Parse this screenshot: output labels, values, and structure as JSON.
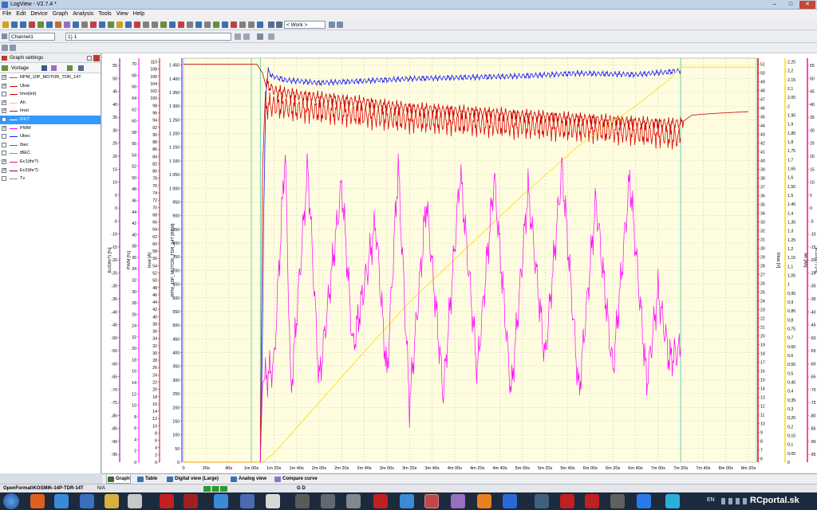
{
  "window": {
    "title": "LogView - V2.7.4 *"
  },
  "menu": [
    "File",
    "Edit",
    "Device",
    "Graph",
    "Analysis",
    "Tools",
    "View",
    "Help"
  ],
  "toolbar": {
    "work_select": "< Work >"
  },
  "channel_bar": {
    "channel_select": "Channel1",
    "session_select": "1) 1"
  },
  "settings": {
    "title": "Graph settings",
    "profile_select": "Vorlage"
  },
  "channels": [
    {
      "label": "RPM_10P_MOTOR_TDR_14T",
      "checked": true,
      "color": "#ff3333"
    },
    {
      "label": "Ubat",
      "checked": true,
      "color": "#cc0000"
    },
    {
      "label": "Imot(int)",
      "checked": false,
      "color": "#bb0000"
    },
    {
      "label": "Ah",
      "checked": true,
      "color": "#ffd800"
    },
    {
      "label": "Imot",
      "checked": true,
      "color": "#e00000"
    },
    {
      "label": "tFET",
      "checked": false,
      "color": "#ffffff",
      "selected": true
    },
    {
      "label": "PWM",
      "checked": true,
      "color": "#ff00ff"
    },
    {
      "label": "Ubec",
      "checked": false,
      "color": "#1a1aff"
    },
    {
      "label": "Ibec",
      "checked": false,
      "color": "#00aa00"
    },
    {
      "label": "tBEC",
      "checked": false,
      "color": "#00c8c8"
    },
    {
      "label": "Ec1(thr?)",
      "checked": true,
      "color": "#ff0080"
    },
    {
      "label": "Ec2(thr?)",
      "checked": true,
      "color": "#800080"
    },
    {
      "label": "Tv",
      "checked": false,
      "color": "#888888"
    }
  ],
  "bottom_tabs": [
    "Graph",
    "Table",
    "Digital view (Large)",
    "Analog view",
    "Compare curve"
  ],
  "status": {
    "file": "OpenFormat\\KOSMIK-14P-TDR-14T",
    "na": "N/A",
    "gd": "G D"
  },
  "taskbar": {
    "lang": "EN",
    "watermark": "RCportal.sk"
  },
  "chart_data": {
    "type": "line",
    "x_ticks": [
      "0",
      "20s",
      "40s",
      "1m 00s",
      "1m 20s",
      "1m 40s",
      "2m 00s",
      "2m 20s",
      "2m 40s",
      "3m 00s",
      "3m 20s",
      "3m 40s",
      "4m 00s",
      "4m 20s",
      "4m 40s",
      "5m 00s",
      "5m 20s",
      "5m 40s",
      "6m 00s",
      "6m 20s",
      "6m 40s",
      "7m 00s",
      "7m 20s",
      "7m 40s",
      "8m 00s",
      "8m 20s"
    ],
    "x_unit_seconds": [
      0,
      20,
      40,
      60,
      80,
      100,
      120,
      140,
      160,
      180,
      200,
      220,
      240,
      260,
      280,
      300,
      320,
      340,
      360,
      380,
      400,
      420,
      440,
      460,
      480,
      500
    ],
    "x_range_seconds": [
      0,
      507
    ],
    "grid": true,
    "plot_background": "#fffde0",
    "axes_left": [
      {
        "id": "ec2",
        "label": "Ec2(thr?) [%]",
        "color": "#800080",
        "ticks": [
          55,
          50,
          45,
          40,
          35,
          30,
          25,
          20,
          15,
          10,
          5,
          0,
          -5,
          -10,
          -15,
          -20,
          -25,
          -30,
          -35,
          -40,
          -45,
          -50,
          -55,
          -60,
          -65,
          -70,
          -75,
          -80,
          -85,
          -90,
          -95
        ]
      },
      {
        "id": "pwm",
        "label": "PWM [%]",
        "color": "#ff00ff",
        "ticks": [
          70,
          68,
          66,
          64,
          62,
          60,
          58,
          56,
          54,
          52,
          50,
          48,
          46,
          44,
          42,
          40,
          38,
          36,
          34,
          32,
          30,
          28,
          26,
          24,
          22,
          20,
          18,
          16,
          14,
          12,
          10,
          8,
          6,
          4,
          2,
          0
        ]
      },
      {
        "id": "imot",
        "label": "Imot [A]",
        "color": "#e00000",
        "ticks": [
          110,
          108,
          106,
          104,
          102,
          100,
          98,
          96,
          94,
          92,
          90,
          88,
          86,
          84,
          82,
          80,
          78,
          76,
          74,
          72,
          70,
          68,
          66,
          64,
          62,
          60,
          58,
          56,
          54,
          52,
          50,
          48,
          46,
          44,
          42,
          40,
          38,
          36,
          34,
          32,
          30,
          28,
          26,
          24,
          22,
          20,
          18,
          16,
          14,
          12,
          10,
          8,
          6,
          4,
          2,
          0
        ]
      },
      {
        "id": "rpm",
        "label": "RPM_10P_MOTOR_TDR_14T [RPM]",
        "color": "#1a1aff",
        "ticks": [
          "1 450",
          "1 400",
          "1 350",
          "1 300",
          "1 250",
          "1 200",
          "1 150",
          "1 100",
          "1 050",
          "1 000",
          "950",
          "900",
          "850",
          "800",
          "750",
          "700",
          "650",
          "600",
          "550",
          "500",
          "450",
          "400",
          "350",
          "300",
          "250",
          "200",
          "150",
          "100",
          "50",
          "0"
        ]
      }
    ],
    "axes_right": [
      {
        "id": "ubat",
        "label": "Ubat [V]",
        "color": "#cc0000",
        "ticks": [
          51,
          50,
          49,
          48,
          47,
          46,
          45,
          44,
          43,
          42,
          41,
          40,
          39,
          38,
          37,
          36,
          35,
          34,
          33,
          32,
          31,
          30,
          29,
          28,
          27,
          26,
          25,
          24,
          23,
          22,
          21,
          20,
          19,
          18,
          17,
          16,
          15,
          14,
          13,
          12,
          11,
          10,
          9,
          8,
          7,
          6
        ]
      },
      {
        "id": "ah",
        "label": "Ah [Ah]",
        "color": "#ffd800",
        "ticks": [
          "2,25",
          "2,2",
          "2,15",
          "2,1",
          "2,05",
          "2",
          "1,95",
          "1,9",
          "1,85",
          "1,8",
          "1,75",
          "1,7",
          "1,65",
          "1,6",
          "1,55",
          "1,5",
          "1,45",
          "1,4",
          "1,35",
          "1,3",
          "1,25",
          "1,2",
          "1,15",
          "1,1",
          "1,05",
          "1",
          "0,95",
          "0,9",
          "0,85",
          "0,8",
          "0,75",
          "0,7",
          "0,65",
          "0,6",
          "0,55",
          "0,5",
          "0,45",
          "0,4",
          "0,35",
          "0,3",
          "0,25",
          "0,2",
          "0,15",
          "0,1",
          "0,05",
          "0"
        ]
      },
      {
        "id": "ec1",
        "label": "Ec1(thr?) [%]",
        "color": "#ff0080",
        "ticks": [
          55,
          50,
          45,
          40,
          35,
          30,
          25,
          20,
          15,
          10,
          5,
          0,
          -5,
          -10,
          -15,
          -20,
          -25,
          -30,
          -35,
          -40,
          -45,
          -50,
          -55,
          -60,
          -65,
          -70,
          -75,
          -80,
          -85,
          -90,
          -95
        ]
      }
    ],
    "series": [
      {
        "name": "RPM_10P_MOTOR_TDR_14T",
        "axis": "rpm",
        "color": "#1a1aff",
        "points": [
          [
            0,
            0
          ],
          [
            68,
            0
          ],
          [
            69,
            200
          ],
          [
            70,
            500
          ],
          [
            71,
            900
          ],
          [
            72,
            1150
          ],
          [
            73,
            1350
          ],
          [
            75,
            1430
          ],
          [
            78,
            1410
          ],
          [
            90,
            1395
          ],
          [
            120,
            1385
          ],
          [
            150,
            1390
          ],
          [
            200,
            1400
          ],
          [
            250,
            1405
          ],
          [
            300,
            1410
          ],
          [
            350,
            1420
          ],
          [
            400,
            1415
          ],
          [
            430,
            1425
          ],
          [
            440,
            1430
          ]
        ]
      },
      {
        "name": "Imot",
        "axis": "imot",
        "color": "#e00000",
        "points": [
          [
            0,
            0
          ],
          [
            68,
            0
          ],
          [
            69,
            40
          ],
          [
            70,
            80
          ],
          [
            72,
            98
          ],
          [
            80,
            98
          ],
          [
            100,
            97
          ],
          [
            140,
            96
          ],
          [
            200,
            94
          ],
          [
            260,
            93
          ],
          [
            320,
            92
          ],
          [
            380,
            91
          ],
          [
            420,
            90
          ],
          [
            440,
            89
          ]
        ]
      },
      {
        "name": "Ubat",
        "axis": "ubat",
        "color": "#cc0000",
        "points": [
          [
            0,
            51
          ],
          [
            65,
            51
          ],
          [
            70,
            50
          ],
          [
            72,
            49
          ],
          [
            80,
            48
          ],
          [
            100,
            47.5
          ],
          [
            150,
            46.8
          ],
          [
            200,
            46
          ],
          [
            250,
            45.6
          ],
          [
            300,
            45.2
          ],
          [
            350,
            44.8
          ],
          [
            400,
            44.4
          ],
          [
            430,
            44.2
          ],
          [
            440,
            44.3
          ],
          [
            450,
            45.2
          ],
          [
            470,
            45.4
          ],
          [
            500,
            45.6
          ]
        ]
      },
      {
        "name": "Ah",
        "axis": "ah",
        "color": "#ffd800",
        "points": [
          [
            0,
            0
          ],
          [
            70,
            0
          ],
          [
            80,
            0.05
          ],
          [
            150,
            0.55
          ],
          [
            200,
            0.9
          ],
          [
            250,
            1.2
          ],
          [
            300,
            1.5
          ],
          [
            350,
            1.78
          ],
          [
            400,
            2.0
          ],
          [
            430,
            2.15
          ],
          [
            440,
            2.22
          ],
          [
            507,
            2.22
          ]
        ]
      },
      {
        "name": "PWM",
        "axis": "pwm",
        "color": "#ff00ff",
        "points": [
          [
            68,
            0
          ],
          [
            70,
            14
          ],
          [
            80,
            17
          ],
          [
            90,
            55
          ],
          [
            95,
            12
          ],
          [
            110,
            52
          ],
          [
            120,
            14
          ],
          [
            140,
            49
          ],
          [
            150,
            20
          ],
          [
            170,
            42
          ],
          [
            180,
            15
          ],
          [
            190,
            52
          ],
          [
            200,
            10
          ],
          [
            215,
            46
          ],
          [
            230,
            12
          ],
          [
            245,
            51
          ],
          [
            260,
            16
          ],
          [
            275,
            50
          ],
          [
            290,
            12
          ],
          [
            305,
            48
          ],
          [
            320,
            18
          ],
          [
            335,
            52
          ],
          [
            350,
            12
          ],
          [
            365,
            46
          ],
          [
            380,
            16
          ],
          [
            395,
            50
          ],
          [
            410,
            14
          ],
          [
            420,
            30
          ],
          [
            430,
            18
          ],
          [
            440,
            20
          ]
        ]
      }
    ],
    "vertical_markers_seconds": [
      60,
      68,
      440
    ]
  }
}
